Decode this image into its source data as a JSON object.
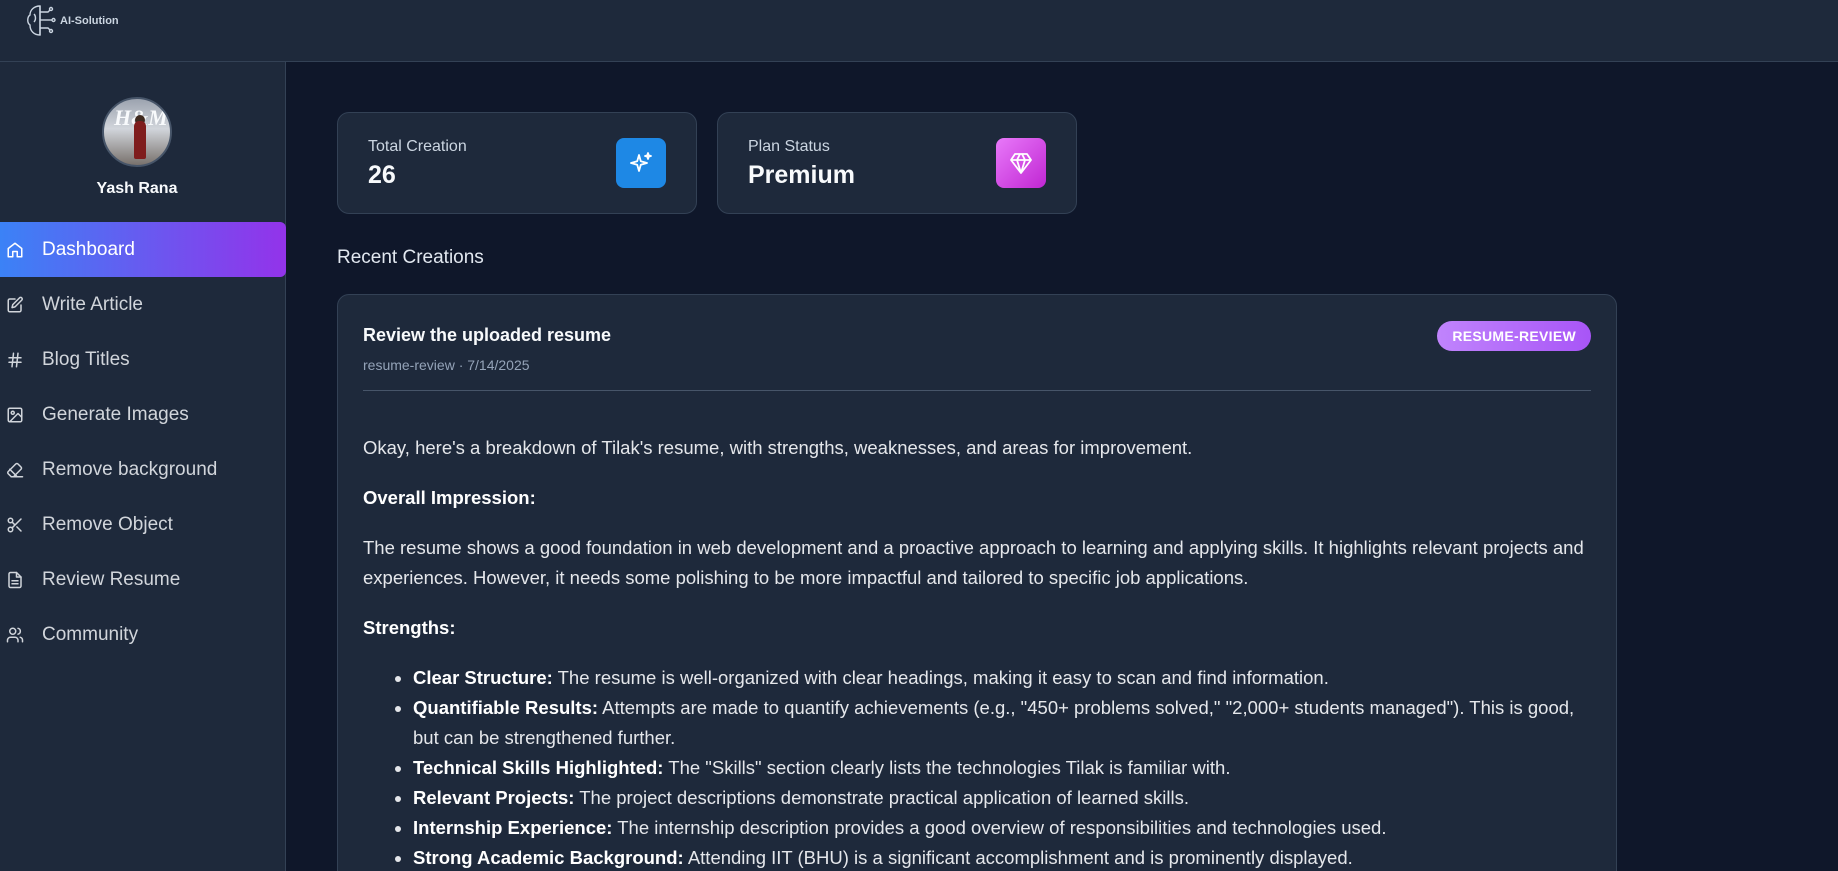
{
  "app": {
    "logo_text": "AI-Solution"
  },
  "user": {
    "name": "Yash Rana",
    "avatar_text": "H&M"
  },
  "sidebar": {
    "items": [
      {
        "label": "Dashboard",
        "icon": "home-icon",
        "active": true
      },
      {
        "label": "Write Article",
        "icon": "edit-icon"
      },
      {
        "label": "Blog Titles",
        "icon": "hash-icon"
      },
      {
        "label": "Generate Images",
        "icon": "image-icon"
      },
      {
        "label": "Remove background",
        "icon": "eraser-icon"
      },
      {
        "label": "Remove Object",
        "icon": "scissors-icon"
      },
      {
        "label": "Review Resume",
        "icon": "file-text-icon"
      },
      {
        "label": "Community",
        "icon": "users-icon"
      }
    ]
  },
  "stats": {
    "total": {
      "label": "Total Creation",
      "value": "26",
      "icon": "sparkles-icon",
      "color": "#1e88e5"
    },
    "plan": {
      "label": "Plan Status",
      "value": "Premium",
      "icon": "gem-icon",
      "color": "#d946ef"
    }
  },
  "recent": {
    "heading": "Recent Creations",
    "item": {
      "title": "Review the uploaded resume",
      "meta": "resume-review · 7/14/2025",
      "badge": "RESUME-REVIEW",
      "intro": "Okay, here's a breakdown of Tilak's resume, with strengths, weaknesses, and areas for improvement.",
      "overall_heading": "Overall Impression:",
      "overall_text": "The resume shows a good foundation in web development and a proactive approach to learning and applying skills. It highlights relevant projects and experiences. However, it needs some polishing to be more impactful and tailored to specific job applications.",
      "strengths_heading": "Strengths:",
      "strengths": [
        {
          "bold": "Clear Structure:",
          "text": " The resume is well-organized with clear headings, making it easy to scan and find information."
        },
        {
          "bold": "Quantifiable Results:",
          "text": " Attempts are made to quantify achievements (e.g., \"450+ problems solved,\" \"2,000+ students managed\"). This is good, but can be strengthened further."
        },
        {
          "bold": "Technical Skills Highlighted:",
          "text": " The \"Skills\" section clearly lists the technologies Tilak is familiar with."
        },
        {
          "bold": "Relevant Projects:",
          "text": " The project descriptions demonstrate practical application of learned skills."
        },
        {
          "bold": "Internship Experience:",
          "text": " The internship description provides a good overview of responsibilities and technologies used."
        },
        {
          "bold": "Strong Academic Background:",
          "text": " Attending IIT (BHU) is a significant accomplishment and is prominently displayed."
        }
      ]
    }
  },
  "colors": {
    "accent_start": "#3b82f6",
    "accent_end": "#9333ea",
    "bg": "#0f172a",
    "panel": "#1e293b"
  }
}
